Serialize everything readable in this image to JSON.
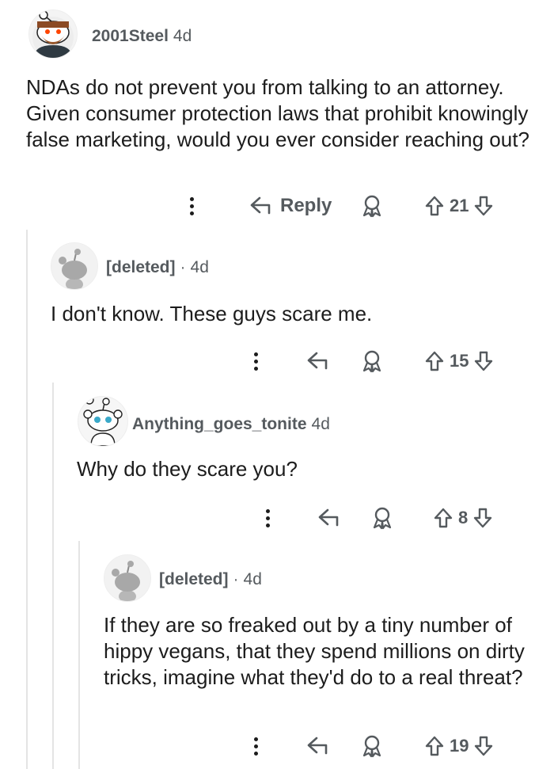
{
  "comments": [
    {
      "username": "2001Steel",
      "separator": "",
      "age": "4d",
      "body": "NDAs do not prevent you from talking to an attorney. Given consumer protection laws that prohibit knowingly false marketing, would you ever consider reaching out?",
      "reply_label": "Reply",
      "votes": "21",
      "avatar_icon": "snoo-bearded-avatar-icon"
    },
    {
      "username": "[deleted]",
      "separator": "·",
      "age": "4d",
      "body": "I don't know. These guys scare me.",
      "reply_label": "",
      "votes": "15",
      "avatar_icon": "snoo-grey-avatar-icon"
    },
    {
      "username": "Anything_goes_tonite",
      "separator": "",
      "age": "4d",
      "body": "Why do they scare you?",
      "reply_label": "",
      "votes": "8",
      "avatar_icon": "snoo-avatar-icon"
    },
    {
      "username": "[deleted]",
      "separator": "·",
      "age": "4d",
      "body": "If they are so freaked out by a tiny number of hippy vegans, that they spend millions on dirty tricks, imagine what they'd do to a real threat?",
      "reply_label": "",
      "votes": "19",
      "avatar_icon": "snoo-grey-avatar-icon"
    }
  ],
  "colors": {
    "text": "#1c1c1c",
    "meta": "#555a5e",
    "thread_line": "#e4e4e4",
    "avatar_cyan": "#3aa9c9",
    "avatar_orange": "#ff4500"
  }
}
